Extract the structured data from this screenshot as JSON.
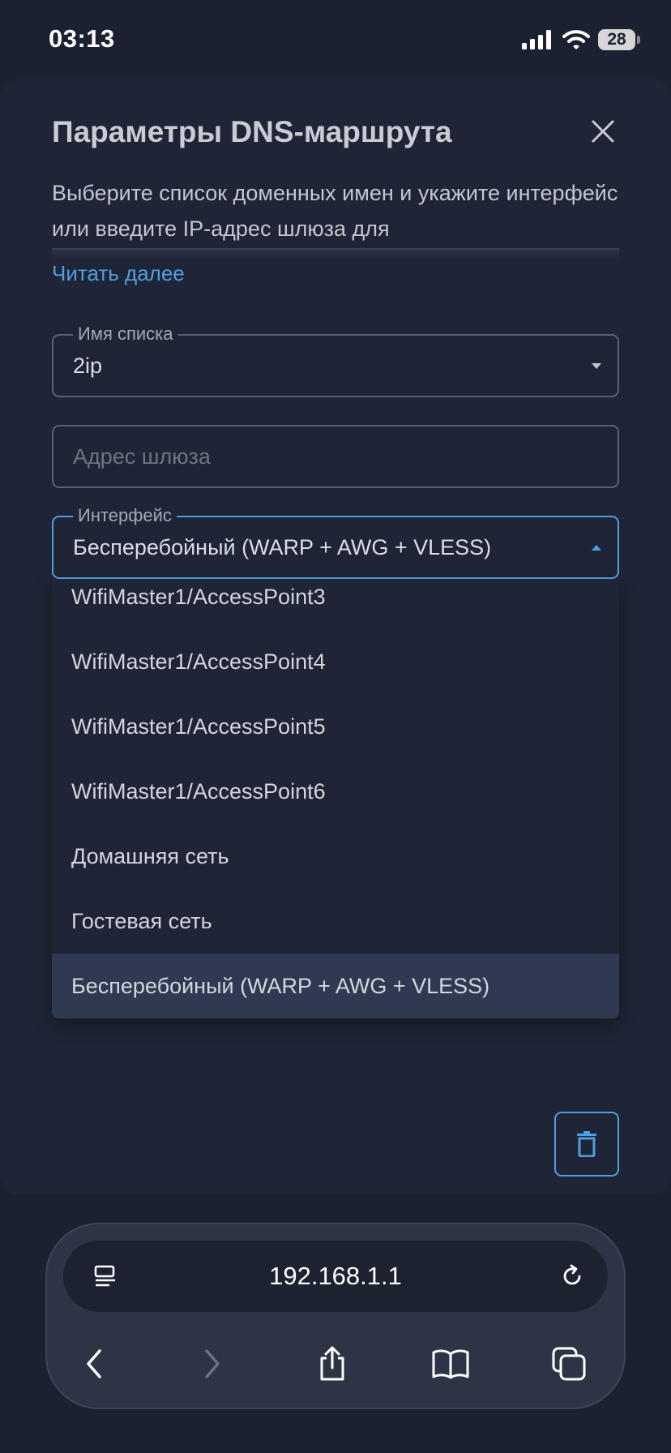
{
  "status": {
    "time": "03:13",
    "battery": "28"
  },
  "dialog": {
    "title": "Параметры DNS-маршрута",
    "description": "Выберите список доменных имен и укажите интерфейс или введите IP-адрес шлюза для",
    "read_more": "Читать далее"
  },
  "list_field": {
    "legend": "Имя списка",
    "value": "2ip"
  },
  "gateway_field": {
    "placeholder": "Адрес шлюза"
  },
  "interface_field": {
    "legend": "Интерфейс",
    "value": "Бесперебойный (WARP + AWG + VLESS)"
  },
  "dropdown": {
    "items": [
      "WifiMaster1/AccessPoint3",
      "WifiMaster1/AccessPoint4",
      "WifiMaster1/AccessPoint5",
      "WifiMaster1/AccessPoint6",
      "Домашняя сеть",
      "Гостевая сеть",
      "Бесперебойный (WARP + AWG + VLESS)"
    ],
    "selected_index": 6
  },
  "browser": {
    "url": "192.168.1.1"
  },
  "colors": {
    "accent": "#4f9fe0",
    "background": "#1b2131",
    "sheet": "#1f2536",
    "selected": "#2f3a52"
  }
}
